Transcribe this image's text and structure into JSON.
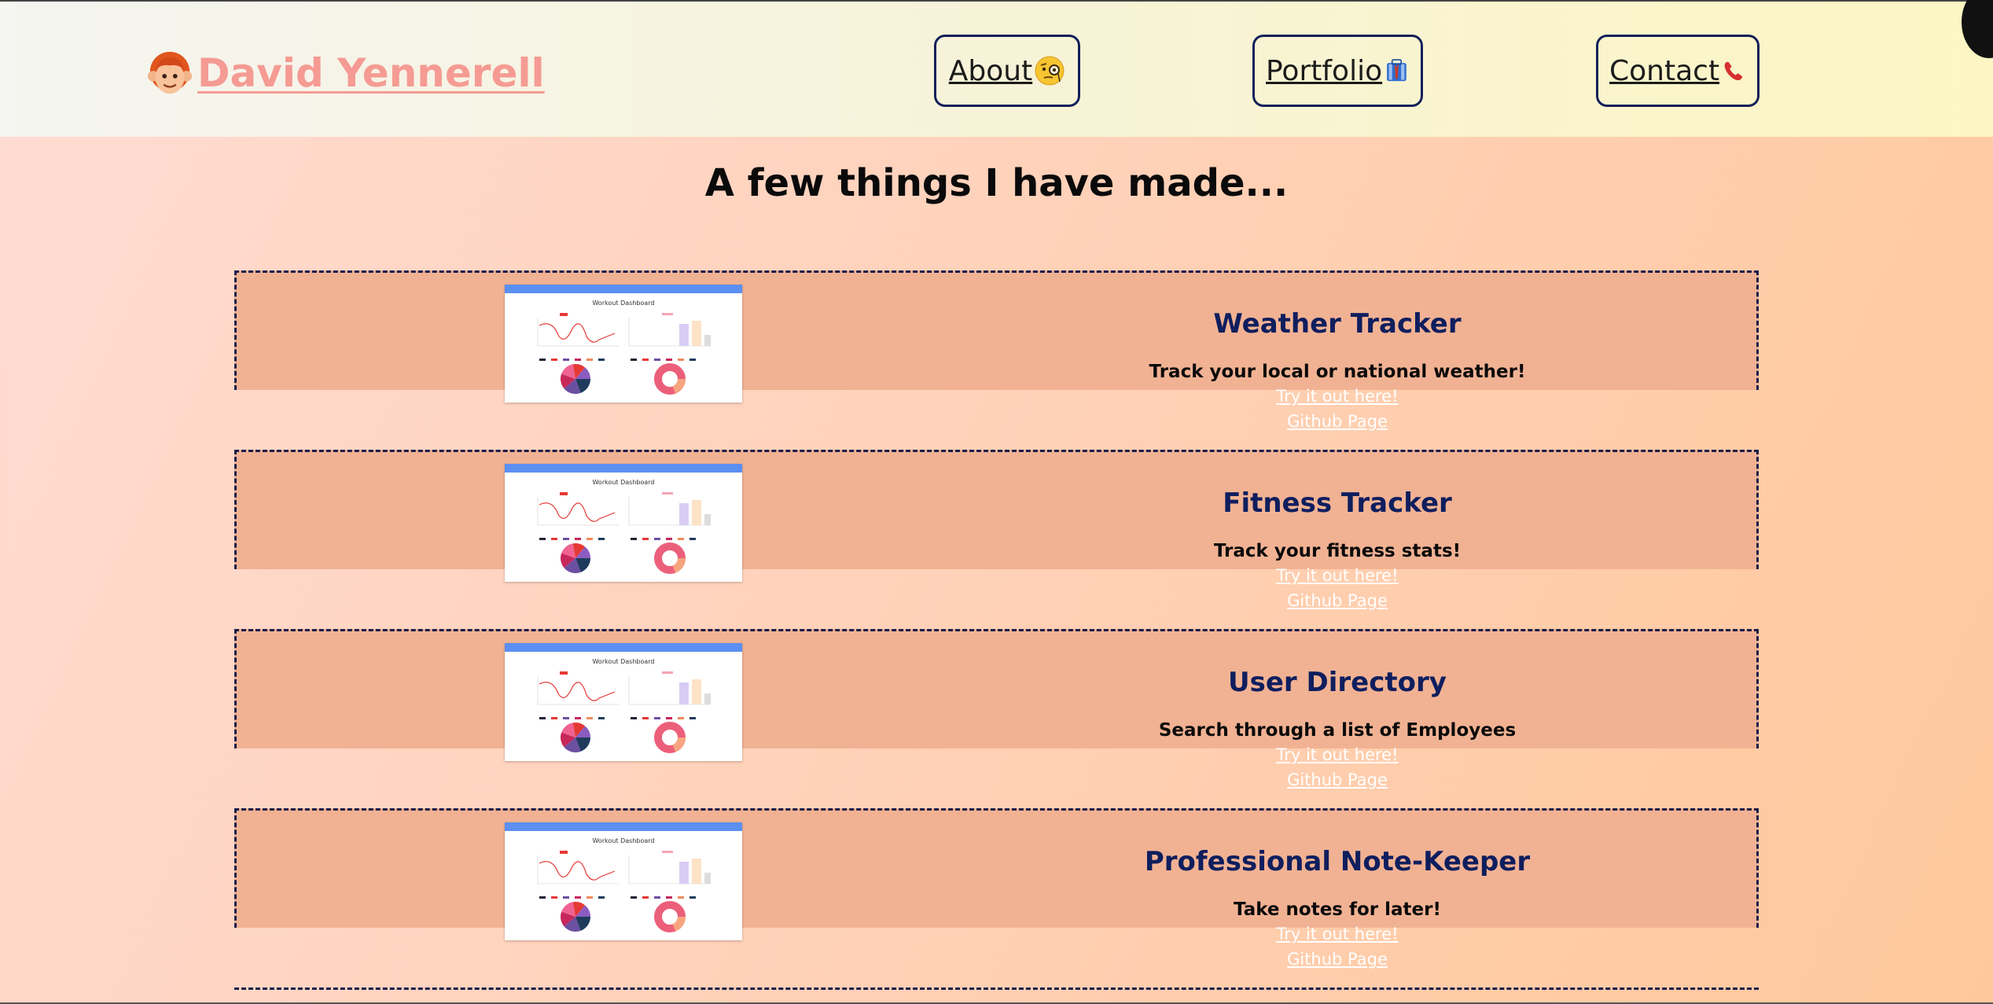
{
  "header": {
    "name": "David Yennerell",
    "nav": [
      {
        "label": "About",
        "icon": "monocle-face-icon"
      },
      {
        "label": "Portfolio",
        "icon": "briefcase-icon"
      },
      {
        "label": "Contact",
        "icon": "telephone-icon"
      }
    ]
  },
  "main": {
    "title": "A few things I have made..."
  },
  "projects": [
    {
      "title": "Weather Tracker",
      "desc": "Track your local or national weather!",
      "link_try": "Try it out here!",
      "link_github": "Github Page"
    },
    {
      "title": "Fitness Tracker",
      "desc": "Track your fitness stats!",
      "link_try": "Try it out here!",
      "link_github": "Github Page"
    },
    {
      "title": "User Directory",
      "desc": "Search through a list of Employees",
      "link_try": "Try it out here!",
      "link_github": "Github Page"
    },
    {
      "title": "Professional Note-Keeper",
      "desc": "Take notes for later!",
      "link_try": "Try it out here!",
      "link_github": "Github Page"
    }
  ],
  "thumbnail": {
    "heading": "Workout Dashboard"
  },
  "colors": {
    "accent": "#f59b93",
    "navy": "#0f1e5e",
    "card": "#f1b293"
  }
}
